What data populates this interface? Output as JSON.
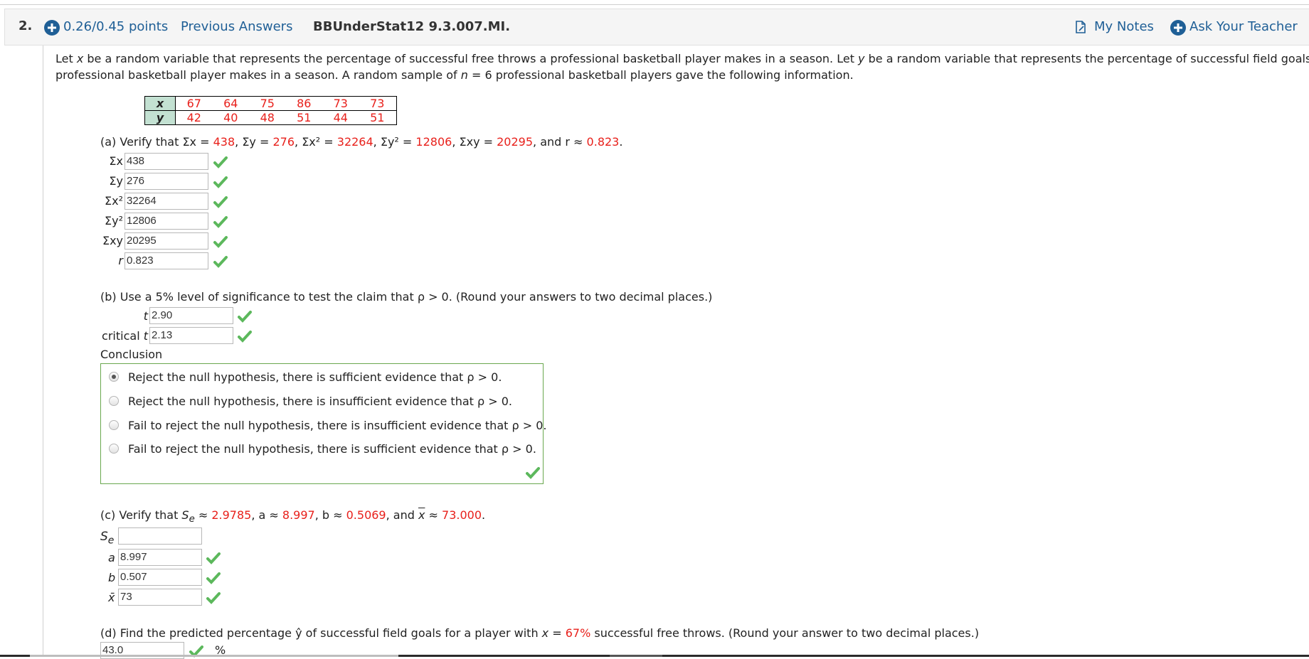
{
  "header": {
    "number": "2.",
    "points": "0.26/0.45 points",
    "previous_answers": "Previous Answers",
    "problem_id": "BBUnderStat12 9.3.007.MI.",
    "my_notes": "My Notes",
    "ask_teacher": "Ask Your Teacher",
    "accent_color": "#1f5f96"
  },
  "problem": {
    "line1_a": "Let ",
    "line1_x": "x",
    "line1_b": " be a random variable that represents the percentage of successful free throws a professional basketball player makes in a season. Let ",
    "line1_y": "y",
    "line1_c": " be a random variable that represents the percentage of successful field goals a",
    "line2_a": "professional basketball player makes in a season. A random sample of ",
    "line2_n": "n",
    "line2_b": " = 6 professional basketball players gave the following information."
  },
  "table": {
    "x_label": "x",
    "y_label": "y",
    "x_values": [
      "67",
      "64",
      "75",
      "86",
      "73",
      "73"
    ],
    "y_values": [
      "42",
      "40",
      "48",
      "51",
      "44",
      "51"
    ]
  },
  "part_a": {
    "prompt_prefix": "(a) Verify that ",
    "sum_x_text": "Σx = ",
    "sum_x": "438",
    "sum_y_text": ", Σy = ",
    "sum_y": "276",
    "sum_x2_text": ", Σx² = ",
    "sum_x2": "32264",
    "sum_y2_text": ", Σy² = ",
    "sum_y2": "12806",
    "sum_xy_text": ", Σxy = ",
    "sum_xy": "20295",
    "r_text": ", and r ≈ ",
    "r": "0.823",
    "end": ".",
    "fields": [
      {
        "label": "Σx",
        "value": "438",
        "correct": true
      },
      {
        "label": "Σy",
        "value": "276",
        "correct": true
      },
      {
        "label": "Σx²",
        "value": "32264",
        "correct": true
      },
      {
        "label": "Σy²",
        "value": "12806",
        "correct": true
      },
      {
        "label": "Σxy",
        "value": "20295",
        "correct": true
      },
      {
        "label": "r",
        "value": "0.823",
        "correct": true
      }
    ]
  },
  "part_b": {
    "prompt": "(b) Use a 5% level of significance to test the claim that ρ > 0. (Round your answers to two decimal places.)",
    "t_label": "t",
    "t_value": "2.90",
    "crit_label_prefix": "critical ",
    "crit_label_var": "t",
    "crit_value": "2.13",
    "conclusion_label": "Conclusion",
    "options": [
      {
        "text": "Reject the null hypothesis, there is sufficient evidence that ρ > 0.",
        "selected": true
      },
      {
        "text": "Reject the null hypothesis, there is insufficient evidence that ρ > 0.",
        "selected": false
      },
      {
        "text": "Fail to reject the null hypothesis, there is insufficient evidence that ρ > 0.",
        "selected": false
      },
      {
        "text": "Fail to reject the null hypothesis, there is sufficient evidence that ρ > 0.",
        "selected": false
      }
    ]
  },
  "part_c": {
    "prompt_prefix": "(c) Verify that ",
    "se_text": "S",
    "se_sub": "e",
    "approx": " ≈ ",
    "se": "2.9785",
    "a_text": ", a ≈ ",
    "a": "8.997",
    "b_text": ", b ≈ ",
    "b": "0.5069",
    "xbar_text_pre": ", and ",
    "xbar_var": "x",
    "xbar_text_post": " ≈ ",
    "xbar": "73.000",
    "end": ".",
    "fields": [
      {
        "label": "Se",
        "value": "",
        "correct": null
      },
      {
        "label": "a",
        "value": "8.997",
        "correct": true
      },
      {
        "label": "b",
        "value": "0.507",
        "correct": true
      },
      {
        "label": "x̄",
        "value": "73",
        "correct": true
      }
    ]
  },
  "part_d": {
    "prompt_a": "(d) Find the predicted percentage ŷ of successful field goals for a player with ",
    "prompt_x": "x",
    "prompt_eq": " = ",
    "prompt_val": "67%",
    "prompt_b": " successful free throws. (Round your answer to two decimal places.)",
    "value": "43.0",
    "unit": "%",
    "correct": true
  },
  "colors": {
    "correct_green": "#5cb85c",
    "given_red": "#e8201b",
    "table_header_fill": "#c3e1d2"
  }
}
